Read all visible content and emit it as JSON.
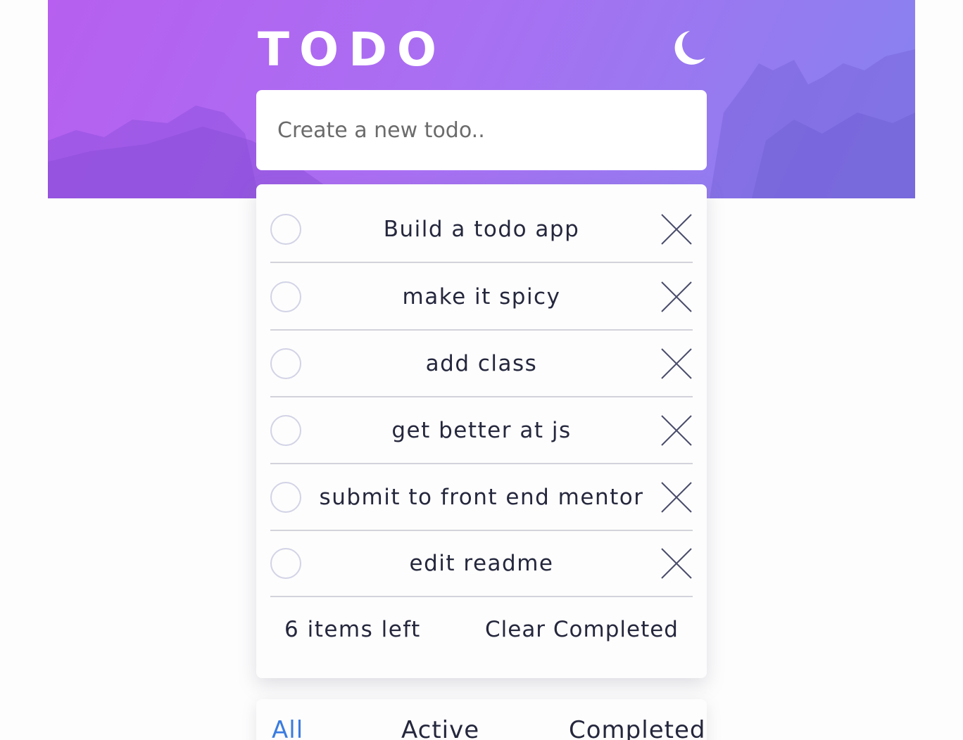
{
  "header": {
    "title": "TODO",
    "theme_toggle_icon": "moon-icon"
  },
  "new_todo": {
    "placeholder": "Create a new todo..",
    "value": ""
  },
  "todos": [
    {
      "text": "Build a todo app",
      "completed": false
    },
    {
      "text": "make it spicy",
      "completed": false
    },
    {
      "text": "add class",
      "completed": false
    },
    {
      "text": "get better at js",
      "completed": false
    },
    {
      "text": "submit to front end mentor",
      "completed": false
    },
    {
      "text": "edit readme",
      "completed": false
    }
  ],
  "footer": {
    "items_left": "6 items left",
    "clear_completed": "Clear Completed"
  },
  "filters": [
    {
      "label": "All",
      "active": true
    },
    {
      "label": "Active",
      "active": false
    },
    {
      "label": "Completed",
      "active": false
    }
  ],
  "colors": {
    "gradient_start": "#b75ff0",
    "gradient_end": "#8683ef",
    "active_filter": "#3a7ce0",
    "text": "#25273d"
  }
}
